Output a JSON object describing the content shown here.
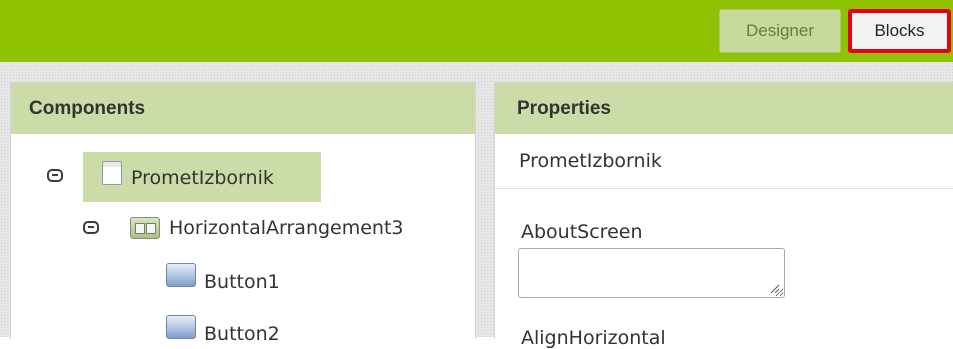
{
  "toolbar": {
    "designer_label": "Designer",
    "blocks_label": "Blocks"
  },
  "components": {
    "title": "Components",
    "tree": [
      {
        "label": "PrometIzbornik",
        "icon": "screen-icon",
        "selected": true
      },
      {
        "label": "HorizontalArrangement3",
        "icon": "horizontal-arrangement-icon"
      },
      {
        "label": "Button1",
        "icon": "button-icon"
      },
      {
        "label": "Button2",
        "icon": "button-icon"
      }
    ]
  },
  "properties": {
    "title": "Properties",
    "component_name": "PrometIzbornik",
    "fields": [
      {
        "label": "AboutScreen",
        "value": ""
      },
      {
        "label": "AlignHorizontal"
      }
    ]
  },
  "colors": {
    "topbar": "#8fc202",
    "panel_header": "#cbdca9",
    "highlight_border": "#e8000b"
  }
}
